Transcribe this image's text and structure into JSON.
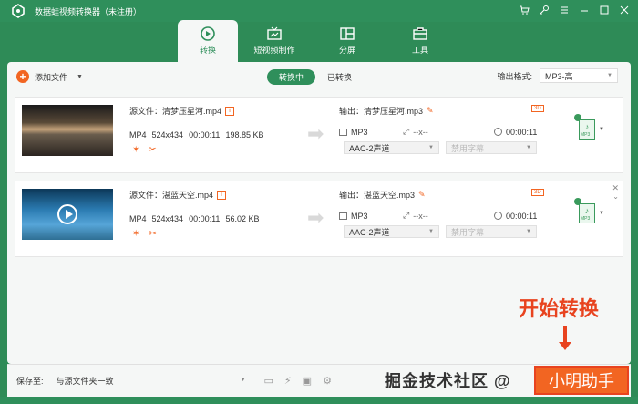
{
  "app": {
    "title": "数据蛙视频转换器（未注册）"
  },
  "tabs": [
    {
      "label": "转换",
      "icon": "convert-icon"
    },
    {
      "label": "短视频制作",
      "icon": "tv-icon"
    },
    {
      "label": "分屏",
      "icon": "split-screen-icon"
    },
    {
      "label": "工具",
      "icon": "toolbox-icon"
    }
  ],
  "toolbar": {
    "add_file": "添加文件",
    "seg_on": "转换中",
    "seg_off": "已转换",
    "output_format_label": "输出格式:",
    "output_format_value": "MP3-高"
  },
  "files": [
    {
      "source": "源文件：清梦压星河.mp4",
      "format": "MP4",
      "resolution": "524x434",
      "duration": "00:00:11",
      "size": "198.85 KB",
      "output": "输出：清梦压星河.mp3",
      "out_format": "MP3",
      "out_res": "--x--",
      "out_duration": "00:00:11",
      "audio": "AAC-2声道",
      "subtitle": "禁用字幕"
    },
    {
      "source": "源文件：湛蓝天空.mp4",
      "format": "MP4",
      "resolution": "524x434",
      "duration": "00:00:11",
      "size": "56.02 KB",
      "output": "输出：湛蓝天空.mp3",
      "out_format": "MP3",
      "out_res": "--x--",
      "out_duration": "00:00:11",
      "audio": "AAC-2声道",
      "subtitle": "禁用字幕"
    }
  ],
  "bottom": {
    "save_label": "保存至:",
    "save_path": "与源文件夹一致",
    "watermark": "掘金技术社区 @",
    "start_button": "小明助手"
  },
  "annotation": {
    "text": "开始转换"
  },
  "colors": {
    "brand_green": "#2f8f5b",
    "accent_orange": "#f26522",
    "annotation_red": "#e8431f"
  }
}
